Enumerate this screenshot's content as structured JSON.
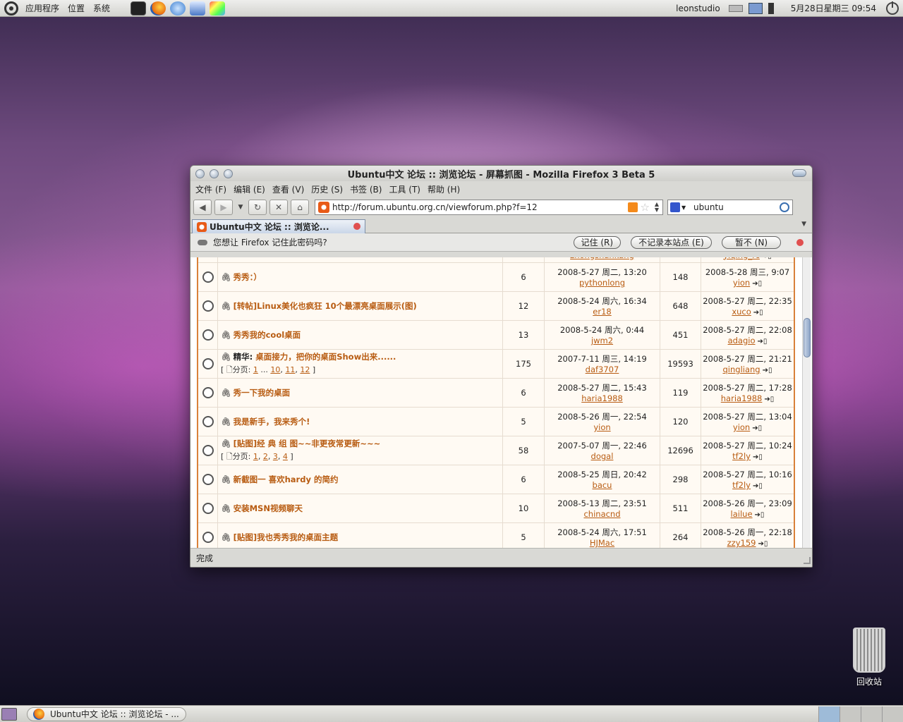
{
  "top_panel": {
    "menus": [
      "应用程序",
      "位置",
      "系统"
    ],
    "launchers": [
      "terminal-icon",
      "firefox-icon",
      "chat-icon",
      "scratch-icon",
      "color-icon"
    ],
    "user": "leonstudio",
    "datetime": "5月28日星期三 09:54"
  },
  "window": {
    "title": "Ubuntu中文 论坛 :: 浏览论坛 - 屏幕抓图 - Mozilla Firefox 3 Beta 5",
    "menus": [
      "文件 (F)",
      "编辑 (E)",
      "查看 (V)",
      "历史 (S)",
      "书签 (B)",
      "工具 (T)",
      "帮助 (H)"
    ],
    "url": "http://forum.ubuntu.org.cn/viewforum.php?f=12",
    "search": "ubuntu",
    "tab_label": "Ubuntu中文 论坛 :: 浏览论...",
    "notification": {
      "text": "您想让 Firefox 记住此密码吗?",
      "remember": "记住 (R)",
      "never": "不记录本站点 (E)",
      "not_now": "暂不 (N)"
    },
    "status": "完成"
  },
  "topics": [
    {
      "prefix": "",
      "title": "",
      "replies": "",
      "author_time": "",
      "author": "zhongshankang",
      "views": "",
      "last_time": "",
      "last_user": "yiqing_rc",
      "first": true
    },
    {
      "prefix": "",
      "title": "秀秀：）",
      "replies": "6",
      "author_time": "2008-5-27 周二, 13:20",
      "author": "pythonlong",
      "views": "148",
      "last_time": "2008-5-28 周三, 9:07",
      "last_user": "yion"
    },
    {
      "prefix": "",
      "title": "[转帖]Linux美化也疯狂 10个最漂亮桌面展示(图)",
      "replies": "12",
      "author_time": "2008-5-24 周六, 16:34",
      "author": "er18",
      "views": "648",
      "last_time": "2008-5-27 周二, 22:35",
      "last_user": "xuco"
    },
    {
      "prefix": "",
      "title": "秀秀我的cool桌面",
      "replies": "13",
      "author_time": "2008-5-24 周六, 0:44",
      "author": "jwm2",
      "views": "451",
      "last_time": "2008-5-27 周二, 22:08",
      "last_user": "adagio"
    },
    {
      "prefix": "精华: ",
      "title": "桌面接力，把你的桌面Show出来......",
      "replies": "175",
      "author_time": "2007-7-11 周三, 14:19",
      "author": "daf3707",
      "views": "19593",
      "last_time": "2008-5-27 周二, 21:21",
      "last_user": "qingliang",
      "pager_label": "分页:",
      "pages": [
        "1",
        "...",
        "10",
        "11",
        "12"
      ]
    },
    {
      "prefix": "",
      "title": "秀一下我的桌面",
      "replies": "6",
      "author_time": "2008-5-27 周二, 15:43",
      "author": "haria1988",
      "views": "119",
      "last_time": "2008-5-27 周二, 17:28",
      "last_user": "haria1988"
    },
    {
      "prefix": "",
      "title": "我是新手，我来秀个!",
      "replies": "5",
      "author_time": "2008-5-26 周一, 22:54",
      "author": "yion",
      "views": "120",
      "last_time": "2008-5-27 周二, 13:04",
      "last_user": "yion"
    },
    {
      "prefix": "",
      "title": "[贴图]经 典 组 图~~非更夜常更新~~~",
      "replies": "58",
      "author_time": "2007-5-07 周一, 22:46",
      "author": "dogal",
      "views": "12696",
      "last_time": "2008-5-27 周二, 10:24",
      "last_user": "tf2ly",
      "pager_label": "分页:",
      "pages": [
        "1",
        "2",
        "3",
        "4"
      ]
    },
    {
      "prefix": "",
      "title": "新截图一 喜欢hardy 的简约",
      "replies": "6",
      "author_time": "2008-5-25 周日, 20:42",
      "author": "bacu",
      "views": "298",
      "last_time": "2008-5-27 周二, 10:16",
      "last_user": "tf2ly"
    },
    {
      "prefix": "",
      "title": "安装MSN视频聊天",
      "replies": "10",
      "author_time": "2008-5-13 周二, 23:51",
      "author": "chinacnd",
      "views": "511",
      "last_time": "2008-5-26 周一, 23:09",
      "last_user": "lailue"
    },
    {
      "prefix": "",
      "title": "[贴图]我也秀秀我的桌面主题",
      "replies": "5",
      "author_time": "2008-5-24 周六, 17:51",
      "author": "HJMac",
      "views": "264",
      "last_time": "2008-5-26 周一, 22:18",
      "last_user": "zzy159"
    }
  ],
  "taskbar": {
    "button": "Ubuntu中文 论坛 :: 浏览论坛 - ..."
  },
  "desktop": {
    "trash_label": "回收站"
  }
}
